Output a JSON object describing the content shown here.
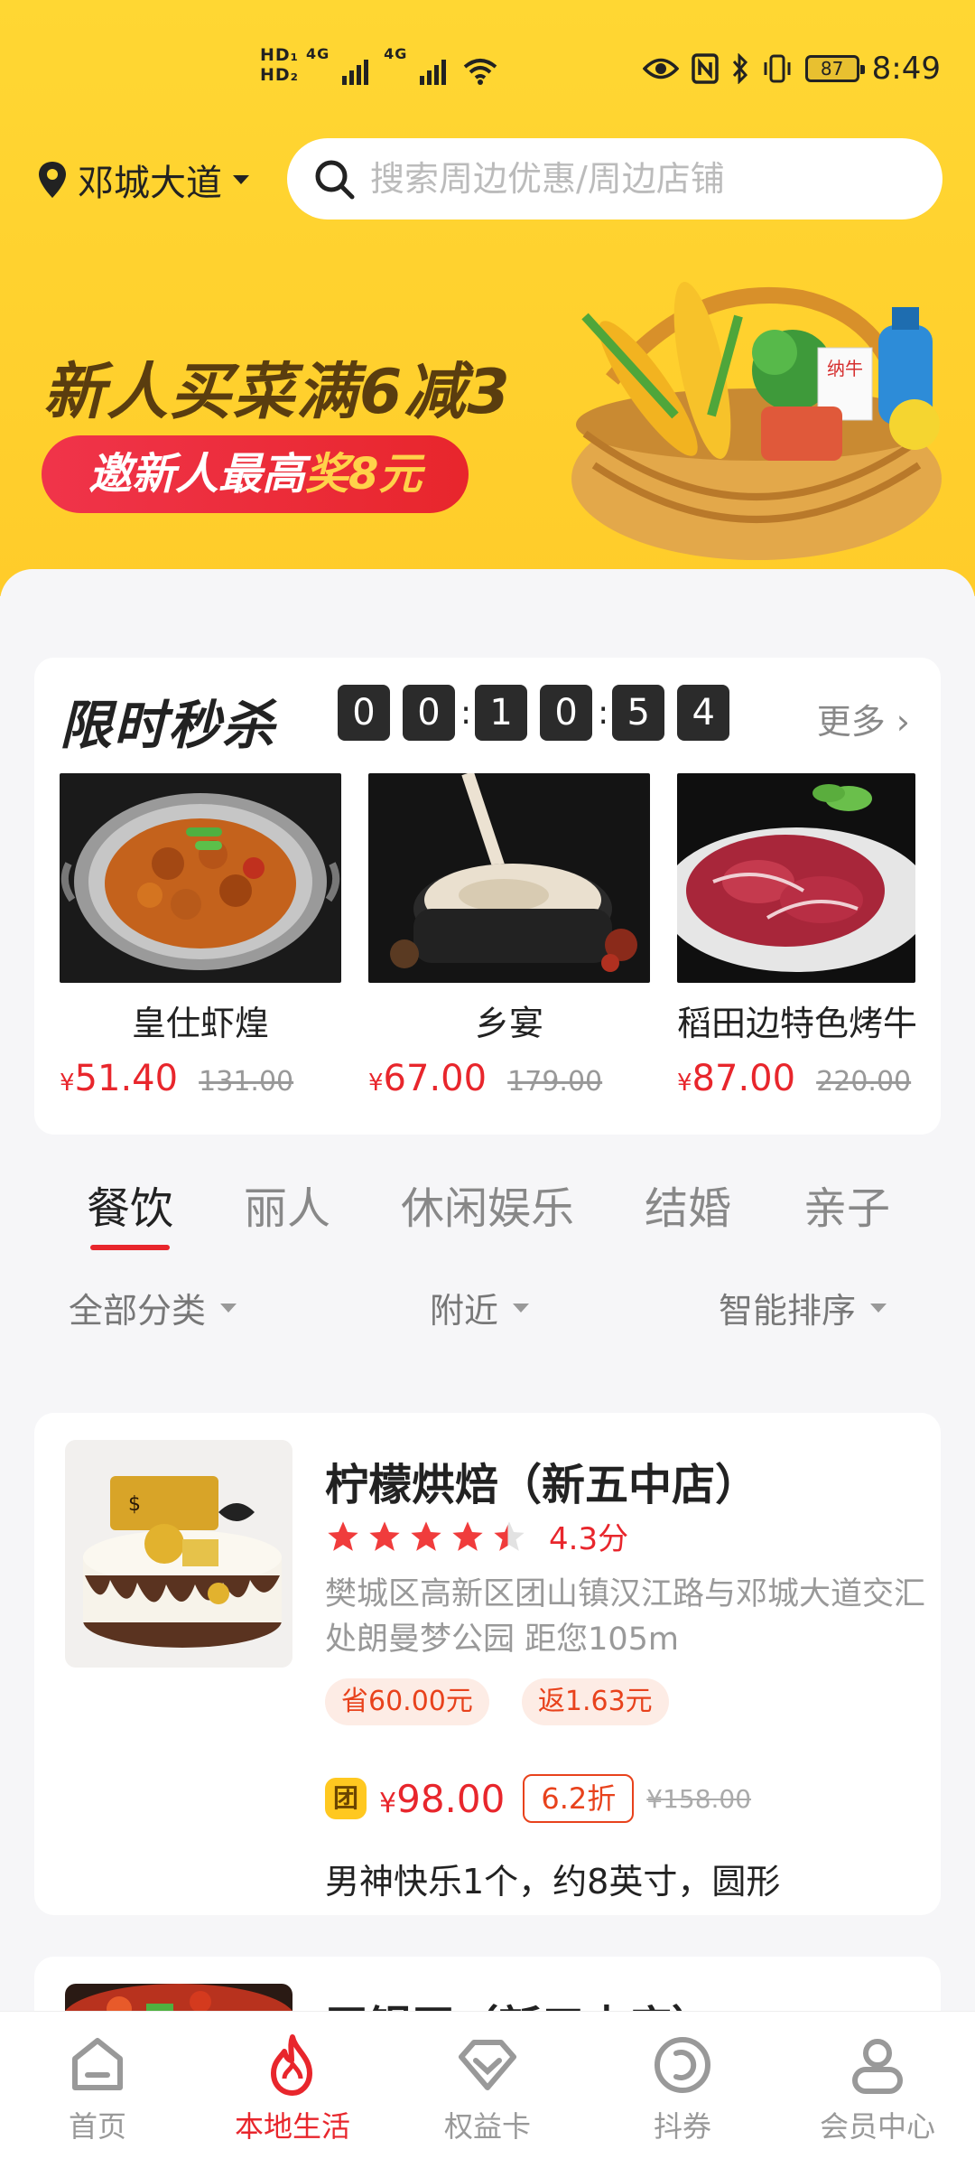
{
  "status_bar": {
    "net_1": "HD₁",
    "net_2": "HD₂",
    "signal_label_1": "4G",
    "signal_label_2": "4G",
    "battery": "87",
    "time": "8:49"
  },
  "header": {
    "location": "邓城大道",
    "search_placeholder": "搜索周边优惠/周边店铺"
  },
  "banner": {
    "title": "新人买菜满6减3",
    "pill_prefix": "邀新人最高",
    "pill_highlight": "奖8元",
    "box_text": "纳牛"
  },
  "flash_sale": {
    "title": "限时秒杀",
    "countdown": [
      "0",
      "0",
      "1",
      "0",
      "5",
      "4"
    ],
    "more": "更多",
    "products": [
      {
        "name": "皇仕虾煌",
        "currency": "¥",
        "price": "51.40",
        "old_price": "131.00"
      },
      {
        "name": "乡宴",
        "currency": "¥",
        "price": "67.00",
        "old_price": "179.00"
      },
      {
        "name": "稻田边特色烤牛",
        "currency": "¥",
        "price": "87.00",
        "old_price": "220.00"
      }
    ]
  },
  "category_tabs": [
    "餐饮",
    "丽人",
    "休闲娱乐",
    "结婚",
    "亲子"
  ],
  "active_tab": "餐饮",
  "filters": [
    "全部分类",
    "附近",
    "智能排序"
  ],
  "shops": [
    {
      "name": "柠檬烘焙（新五中店）",
      "rating": 4.3,
      "rating_text": "4.3分",
      "address": "樊城区高新区团山镇汉江路与邓城大道交汇处朗曼梦公园  距您105m",
      "tags": [
        "省60.00元",
        "返1.63元"
      ],
      "deal_badge": "团",
      "currency": "¥",
      "price": "98.00",
      "discount": "6.2折",
      "old_price": "¥158.00",
      "deal_desc": "男神快乐1个，约8英寸，圆形"
    },
    {
      "name": "王锅王（新五中店）"
    }
  ],
  "bottom_nav": [
    {
      "label": "首页",
      "icon": "home-icon"
    },
    {
      "label": "本地生活",
      "icon": "flame-icon"
    },
    {
      "label": "权益卡",
      "icon": "diamond-icon"
    },
    {
      "label": "抖券",
      "icon": "coupon-icon"
    },
    {
      "label": "会员中心",
      "icon": "user-icon"
    }
  ],
  "colors": {
    "header_yellow": "#ffd733",
    "accent_red": "#e8262c",
    "text_dark": "#222222"
  }
}
